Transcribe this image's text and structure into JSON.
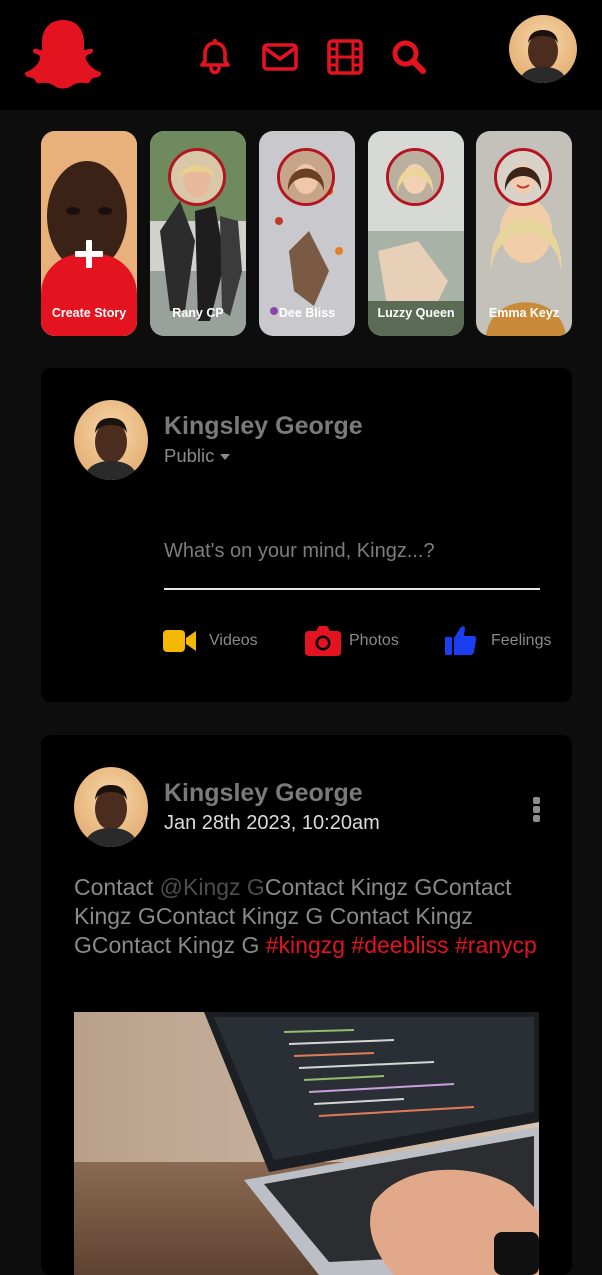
{
  "app": {
    "brand_color": "#e3131f",
    "background": "#0d0d0d",
    "card_color": "#000000"
  },
  "header": {
    "logo": "ghost-logo-icon",
    "nav": [
      {
        "icon": "bell-icon"
      },
      {
        "icon": "mail-icon"
      },
      {
        "icon": "film-icon"
      },
      {
        "icon": "search-icon"
      }
    ],
    "profile_avatar": "user-avatar"
  },
  "stories": [
    {
      "label": "Create Story",
      "kind": "create"
    },
    {
      "label": "Rany CP"
    },
    {
      "label": "Dee Bliss"
    },
    {
      "label": "Luzzy Queen"
    },
    {
      "label": "Emma Keyz"
    }
  ],
  "composer": {
    "user_name": "Kingsley George",
    "audience": "Public",
    "placeholder": "What's on your mind, Kingz...?",
    "actions": [
      {
        "label": "Videos",
        "icon": "video-camera-icon",
        "color": "#f5b800"
      },
      {
        "label": "Photos",
        "icon": "camera-icon",
        "color": "#e3131f"
      },
      {
        "label": "Feelings",
        "icon": "thumbs-up-icon",
        "color": "#1a3ff0"
      }
    ]
  },
  "post": {
    "author": "Kingsley George",
    "date": "Jan 28th 2023, 10:20am",
    "text_before": "Contact ",
    "mention": "@Kingz G",
    "text_after": "Contact Kingz GContact Kingz GContact Kingz G Contact Kingz GContact Kingz G ",
    "hashtags": [
      "#kingzg",
      "#deebliss",
      "#ranycp"
    ]
  }
}
